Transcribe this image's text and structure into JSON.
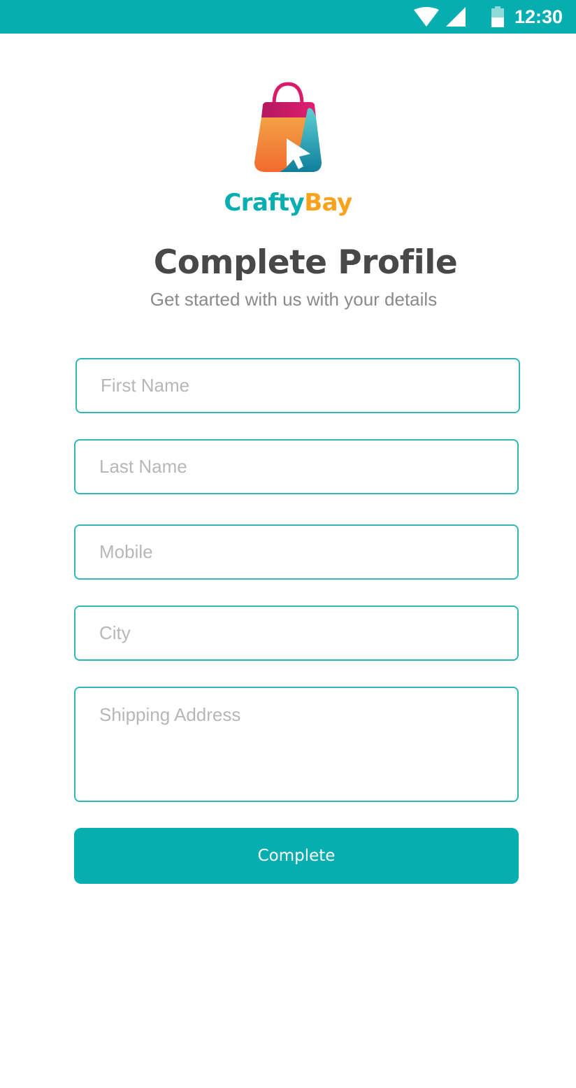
{
  "status_bar": {
    "time": "12:30",
    "icons": [
      "wifi-icon",
      "cell-signal-icon",
      "battery-icon"
    ],
    "background_color": "#07AEAF"
  },
  "brand": {
    "name_part1": "Crafty",
    "name_part2": "Bay",
    "color_primary": "#07AEAF",
    "color_secondary": "#F8A31B",
    "logo_icon": "shopping-bag-cursor-icon"
  },
  "header": {
    "title": "Complete Profile",
    "subtitle": "Get started with us with your details"
  },
  "form": {
    "first_name": {
      "placeholder": "First Name",
      "value": ""
    },
    "last_name": {
      "placeholder": "Last Name",
      "value": ""
    },
    "mobile": {
      "placeholder": "Mobile",
      "value": ""
    },
    "city": {
      "placeholder": "City",
      "value": ""
    },
    "shipping_address": {
      "placeholder": "Shipping Address",
      "value": ""
    },
    "submit_label": "Complete",
    "border_color": "#30b8b8",
    "button_color": "#07AEAF"
  }
}
